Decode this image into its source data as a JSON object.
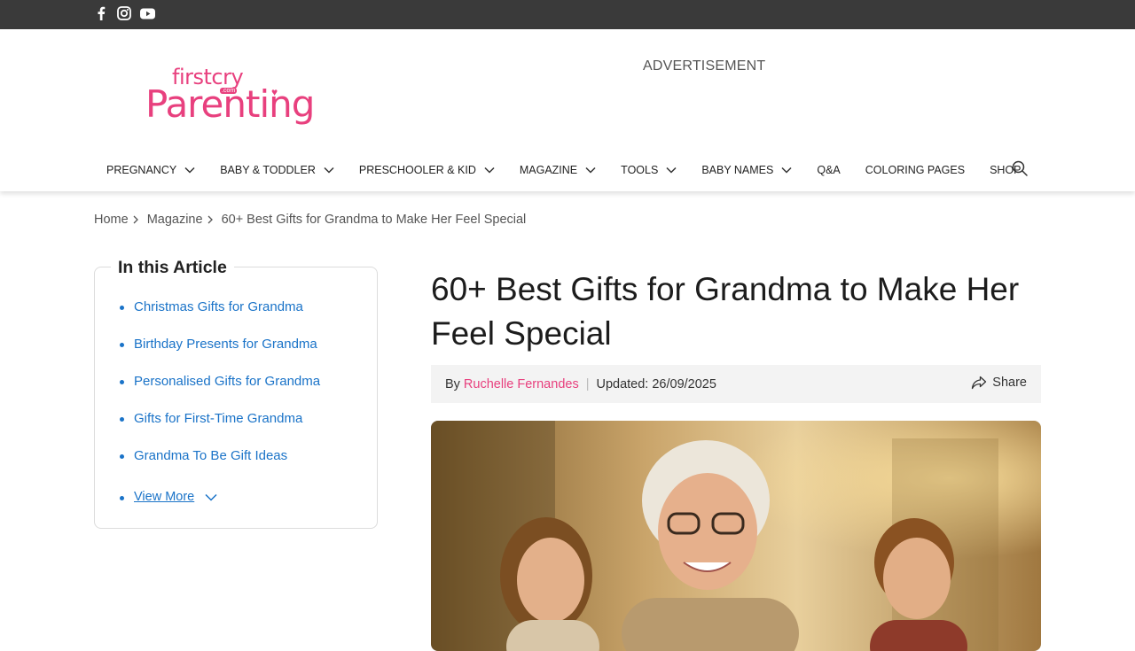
{
  "topbar": {
    "social_icons": [
      "facebook-icon",
      "instagram-icon",
      "youtube-icon"
    ]
  },
  "logo": {
    "top_text": "firstcry",
    "com_text": ".com",
    "main_text": "Parenting"
  },
  "advertisement_label": "ADVERTISEMENT",
  "nav": {
    "items": [
      {
        "label": "PREGNANCY",
        "has_dropdown": true
      },
      {
        "label": "BABY & TODDLER",
        "has_dropdown": true
      },
      {
        "label": "PRESCHOOLER & KID",
        "has_dropdown": true
      },
      {
        "label": "MAGAZINE",
        "has_dropdown": true
      },
      {
        "label": "TOOLS",
        "has_dropdown": true
      },
      {
        "label": "BABY NAMES",
        "has_dropdown": true
      },
      {
        "label": "Q&A",
        "has_dropdown": false
      },
      {
        "label": "COLORING PAGES",
        "has_dropdown": false
      },
      {
        "label": "SHOP",
        "has_dropdown": false
      }
    ],
    "search_icon": "search-icon"
  },
  "breadcrumb": {
    "items": [
      "Home",
      "Magazine",
      "60+ Best Gifts for Grandma to Make Her Feel Special"
    ]
  },
  "toc": {
    "title": "In this Article",
    "items": [
      "Christmas Gifts for Grandma",
      "Birthday Presents for Grandma",
      "Personalised Gifts for Grandma",
      "Gifts for First-Time Grandma",
      "Grandma To Be Gift Ideas"
    ],
    "view_more": "View More"
  },
  "article": {
    "title": "60+ Best Gifts for Grandma to Make Her Feel Special",
    "by_label": "By",
    "author": "Ruchelle Fernandes",
    "pipe": "|",
    "updated": "Updated: 26/09/2025",
    "share_label": "Share"
  },
  "colors": {
    "topbar": "#3a3a3a",
    "brand_pink": "#e8407e",
    "link_blue": "#1a73c8",
    "byline_bg": "#f3f3f3"
  }
}
